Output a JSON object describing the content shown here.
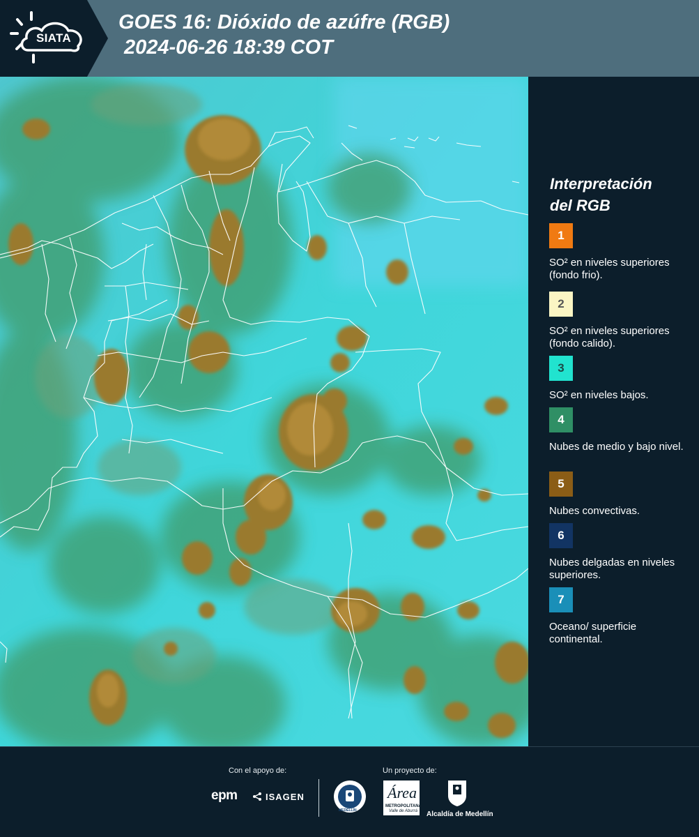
{
  "header": {
    "logo_text": "SIATA",
    "title_line1": "GOES 16: Dióxido de azúfre (RGB)",
    "title_line2": "2024-06-26 18:39 COT"
  },
  "legend": {
    "title_line1": "Interpretación",
    "title_line2": "del RGB",
    "items": [
      {
        "number": "1",
        "label": "SO² en niveles superiores (fondo frio).",
        "color": "#f07a12",
        "text_color": "#ffffff"
      },
      {
        "number": "2",
        "label": "SO² en niveles superiores (fondo calido).",
        "color": "#fbf5c4",
        "text_color": "#555555"
      },
      {
        "number": "3",
        "label": "SO² en niveles bajos.",
        "color": "#21e3cf",
        "text_color": "#1b4b47"
      },
      {
        "number": "4",
        "label": "Nubes de medio y bajo nivel.",
        "color": "#2f8f65",
        "text_color": "#ffffff"
      },
      {
        "number": "5",
        "label": "Nubes convectivas.",
        "color": "#8b5d16",
        "text_color": "#ffffff"
      },
      {
        "number": "6",
        "label": "Nubes delgadas en niveles superiores.",
        "color": "#123463",
        "text_color": "#ffffff"
      },
      {
        "number": "7",
        "label": "Oceano/ superficie continental.",
        "color": "#1a8fb8",
        "text_color": "#ffffff"
      }
    ]
  },
  "footer": {
    "support_label": "Con el apoyo de:",
    "project_label": "Un proyecto de:",
    "epm": "epm",
    "isagen": "ISAGEN",
    "area_script": "Área",
    "area_line1": "METROPOLITANA",
    "area_line2": "Valle de Aburrá",
    "alcaldia": "Alcaldía de Medellín",
    "seal_text": "MEDELLÍN"
  },
  "colors": {
    "header_bg": "#4e6e7d",
    "panel_bg": "#0c1e2b",
    "map_base": "#3fd2d9",
    "cloud_convective": "#9a7a2e",
    "cloud_low": "#3f9b6a"
  }
}
